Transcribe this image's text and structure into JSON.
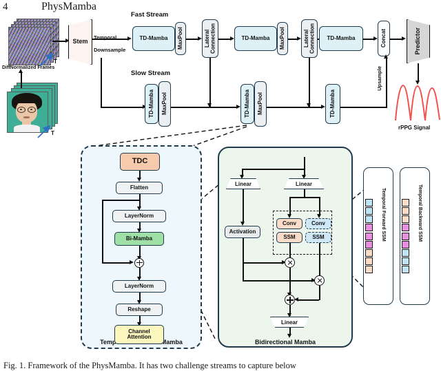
{
  "page": {
    "number": "4",
    "running_title": "PhysMamba"
  },
  "caption": "Fig. 1. Framework of the PhysMamba. It has two challenge streams to capture below",
  "input": {
    "diff_label": "DiffNormalized  Frames",
    "t_label_top": "T",
    "t_label_bottom": "T",
    "stem_label": "Stem",
    "downsample_label_line1": "Temporal",
    "downsample_label_line2": "Downsample"
  },
  "streams": {
    "fast_label": "Fast Stream",
    "slow_label": "Slow Stream",
    "fast_nodes": [
      "TD-Mamba",
      "MaxPool",
      "Lateral Connection",
      "TD-Mamba",
      "MaxPool",
      "Lateral Connection",
      "TD-Mamba"
    ],
    "slow_nodes": [
      "TD-Mamba",
      "MaxPool",
      "TD-Mamba",
      "MaxPool",
      "TD-Mamba"
    ],
    "lateral_label_line1": "Lateral",
    "lateral_label_line2": "Connection",
    "maxpool_label": "MaxPool",
    "tdmamba_label": "TD-Mamba",
    "upsample_label": "Upsample",
    "concat_label": "Concat",
    "predictor_label": "Predictor",
    "output_label": "rPPG Signal"
  },
  "tdm_panel": {
    "title": "Temporal Difference Mamba",
    "nodes": [
      {
        "label": "TDC",
        "color": "#f7c9ad"
      },
      {
        "label": "Flatten",
        "color": "#eff1f2"
      },
      {
        "label": "LayerNorm",
        "color": "#eff1f2"
      },
      {
        "label": "Bi-Mamba",
        "color": "#9ee0a6"
      },
      {
        "label": "LayerNorm",
        "color": "#eff1f2"
      },
      {
        "label": "Reshape",
        "color": "#eff1f2"
      },
      {
        "label": "Channel Attention",
        "color": "#fbf7bf"
      }
    ],
    "channel_attention_line1": "Channel",
    "channel_attention_line2": "Attention",
    "residual_op": "plus"
  },
  "bim_panel": {
    "title": "Bidirectional Mamba",
    "linear_left_label": "Linear",
    "linear_right_label": "Linear",
    "activation_label": "Activation",
    "linear_out_label": "Linear",
    "forward_branch": [
      {
        "label": "Conv",
        "color": "#fbdcc8"
      },
      {
        "label": "SSM",
        "color": "#fbdcc8"
      }
    ],
    "backward_branch": [
      {
        "label": "Conv",
        "color": "#cfe7f7"
      },
      {
        "label": "SSM",
        "color": "#cfe7f7"
      }
    ],
    "ops": [
      "multiply",
      "multiply",
      "plus"
    ]
  },
  "ssm_strips": [
    {
      "label": "Temporal Forward SSM",
      "tokens": [
        "#bfe4f5",
        "#bfe4f5",
        "#bfe4f5",
        "#e88fe0",
        "#e88fe0",
        "#e88fe0",
        "#fbdcc8",
        "#fbdcc8",
        "#fbdcc8"
      ]
    },
    {
      "label": "Temporal Backward SSM",
      "tokens": [
        "#fbdcc8",
        "#fbdcc8",
        "#fbdcc8",
        "#e88fe0",
        "#e88fe0",
        "#e88fe0",
        "#bfe4f5",
        "#bfe4f5",
        "#bfe4f5"
      ]
    }
  ],
  "colors": {
    "mamba_blue": "#ddf1f7",
    "gray_node": "#eceff1",
    "tdc_peach": "#f7c9ad",
    "bimamba_green": "#9ee0a6",
    "channel_yellow": "#fbf7bf",
    "signal_red": "#f2524f",
    "outline": "#1f3a4d"
  }
}
